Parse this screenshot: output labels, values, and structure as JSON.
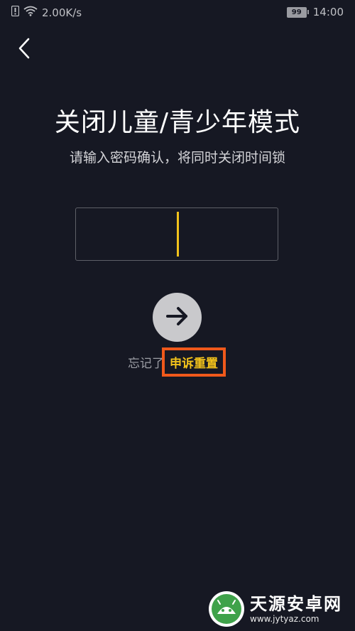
{
  "status_bar": {
    "net_speed": "2.00K/s",
    "battery_level": "99",
    "time": "14:00"
  },
  "page": {
    "title": "关闭儿童/青少年模式",
    "subtitle": "请输入密码确认，将同时关闭时间锁"
  },
  "forgot": {
    "text": "忘记了",
    "appeal_label": "申诉重置"
  },
  "watermark": {
    "name": "天源安卓网",
    "url": "www.jytyaz.com"
  },
  "colors": {
    "background": "#161823",
    "accent": "#f2c21b",
    "highlight_box": "#f0591b"
  },
  "icons": [
    "alert-icon",
    "wifi-icon",
    "battery-icon",
    "back-arrow-icon",
    "arrow-right-icon",
    "watermark-logo-icon"
  ]
}
